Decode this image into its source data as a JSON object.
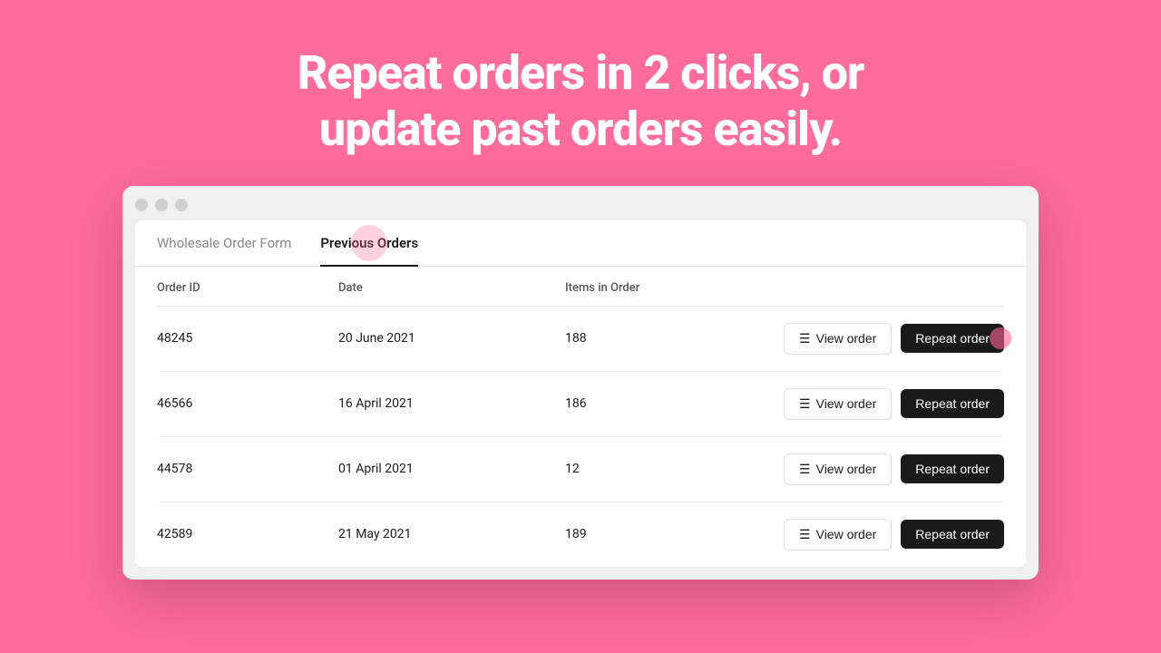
{
  "hero": {
    "line1": "Repeat orders in 2 clicks, or",
    "line2": "update past orders easily."
  },
  "browser": {
    "tabs": [
      {
        "id": "wholesale",
        "label": "Wholesale Order Form",
        "active": false
      },
      {
        "id": "previous",
        "label": "Previous Orders",
        "active": true
      }
    ],
    "table": {
      "columns": [
        "Order ID",
        "Date",
        "Items in Order",
        ""
      ],
      "rows": [
        {
          "id": "48245",
          "date": "20 June 2021",
          "items": "188"
        },
        {
          "id": "46566",
          "date": "16 April 2021",
          "items": "186"
        },
        {
          "id": "44578",
          "date": "01 April 2021",
          "items": "12"
        },
        {
          "id": "42589",
          "date": "21 May 2021",
          "items": "189"
        }
      ],
      "view_label": "View order",
      "repeat_label": "Repeat order"
    }
  }
}
